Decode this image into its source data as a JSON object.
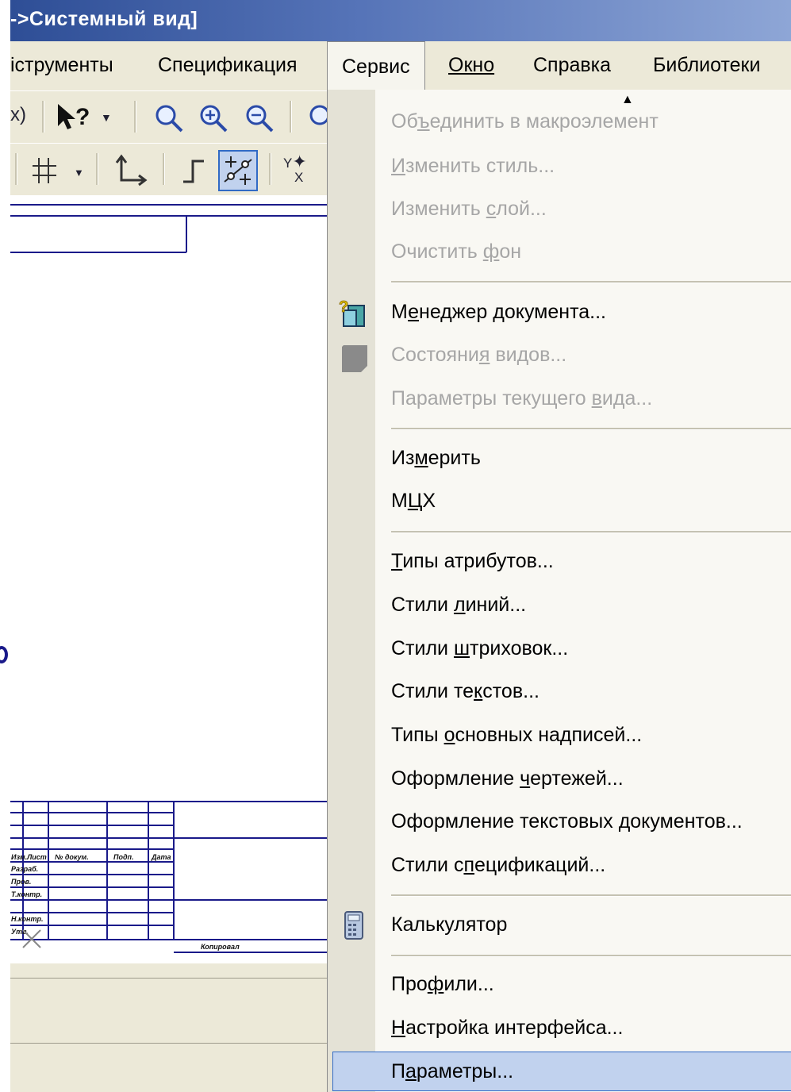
{
  "window": {
    "title": "->Системный вид]"
  },
  "menubar": {
    "items": [
      {
        "id": "tools",
        "label": "іструменты"
      },
      {
        "id": "spec",
        "label": "Спецификация"
      },
      {
        "id": "service",
        "label": "Сервис",
        "open": true
      },
      {
        "id": "window",
        "label": "Окно"
      },
      {
        "id": "help",
        "label": "Справка"
      },
      {
        "id": "libraries",
        "label": "Библиотеки"
      }
    ]
  },
  "toolbar": {
    "row1": {
      "fx_label": "x)",
      "help_label": "?"
    },
    "row2": {
      "coord_label": "Y",
      "coord_label2": "X"
    }
  },
  "title_block": {
    "col1": "Изм.Лист",
    "col2": "№ докум.",
    "col3": "Подп.",
    "col4": "Дата",
    "r1": "Разраб.",
    "r2": "Пров.",
    "r3": "Т.контр.",
    "r4": "Н.контр.",
    "r5": "Утв.",
    "caption": "Копировал"
  },
  "service_menu": {
    "scroll_up": "▲",
    "items": [
      {
        "label_pre": "Об",
        "label_u": "ъ",
        "label_post": "единить в макроэлемент",
        "disabled": true
      },
      {
        "label_pre": "",
        "label_u": "И",
        "label_post": "зменить стиль...",
        "disabled": true
      },
      {
        "label_pre": "Изменить ",
        "label_u": "с",
        "label_post": "лой...",
        "disabled": true
      },
      {
        "label_pre": "Очистить ",
        "label_u": "ф",
        "label_post": "он",
        "disabled": true
      },
      {
        "label_pre": "М",
        "label_u": "е",
        "label_post": "неджер документа...",
        "disabled": false,
        "icon": "document-manager-icon"
      },
      {
        "label_pre": "Состояни",
        "label_u": "я",
        "label_post": " видов...",
        "disabled": true,
        "icon": "view-states-icon"
      },
      {
        "label_pre": "Параметры текущего ",
        "label_u": "в",
        "label_post": "ида...",
        "disabled": true
      },
      {
        "label_pre": "Из",
        "label_u": "м",
        "label_post": "ерить",
        "disabled": false
      },
      {
        "label_pre": "М",
        "label_u": "Ц",
        "label_post": "Х",
        "disabled": false
      },
      {
        "label_pre": "",
        "label_u": "Т",
        "label_post": "ипы атрибутов...",
        "disabled": false
      },
      {
        "label_pre": "Стили ",
        "label_u": "л",
        "label_post": "иний...",
        "disabled": false
      },
      {
        "label_pre": "Стили ",
        "label_u": "ш",
        "label_post": "триховок...",
        "disabled": false
      },
      {
        "label_pre": "Стили те",
        "label_u": "к",
        "label_post": "стов...",
        "disabled": false
      },
      {
        "label_pre": "Типы ",
        "label_u": "о",
        "label_post": "сновных надписей...",
        "disabled": false
      },
      {
        "label_pre": "Оформление ",
        "label_u": "ч",
        "label_post": "ертежей...",
        "disabled": false
      },
      {
        "label_pre": "Оформление текстовых ",
        "label_u": "д",
        "label_post": "окументов...",
        "disabled": false
      },
      {
        "label_pre": "Стили с",
        "label_u": "п",
        "label_post": "ецификаций...",
        "disabled": false
      },
      {
        "label_pre": "Калькулятор",
        "label_u": "",
        "label_post": "",
        "disabled": false,
        "icon": "calculator-icon"
      },
      {
        "label_pre": "Про",
        "label_u": "ф",
        "label_post": "или...",
        "disabled": false
      },
      {
        "label_pre": "",
        "label_u": "Н",
        "label_post": "астройка интерфейса...",
        "disabled": false
      },
      {
        "label_pre": "П",
        "label_u": "а",
        "label_post": "раметры...",
        "disabled": false,
        "highlighted": true
      }
    ]
  },
  "colors": {
    "accent": "#316ac5",
    "titlebar": "#2e4e96",
    "menu_bg": "#f9f8f3",
    "disabled": "#a6a6a6",
    "drawing_lines": "#1a1a8a"
  }
}
